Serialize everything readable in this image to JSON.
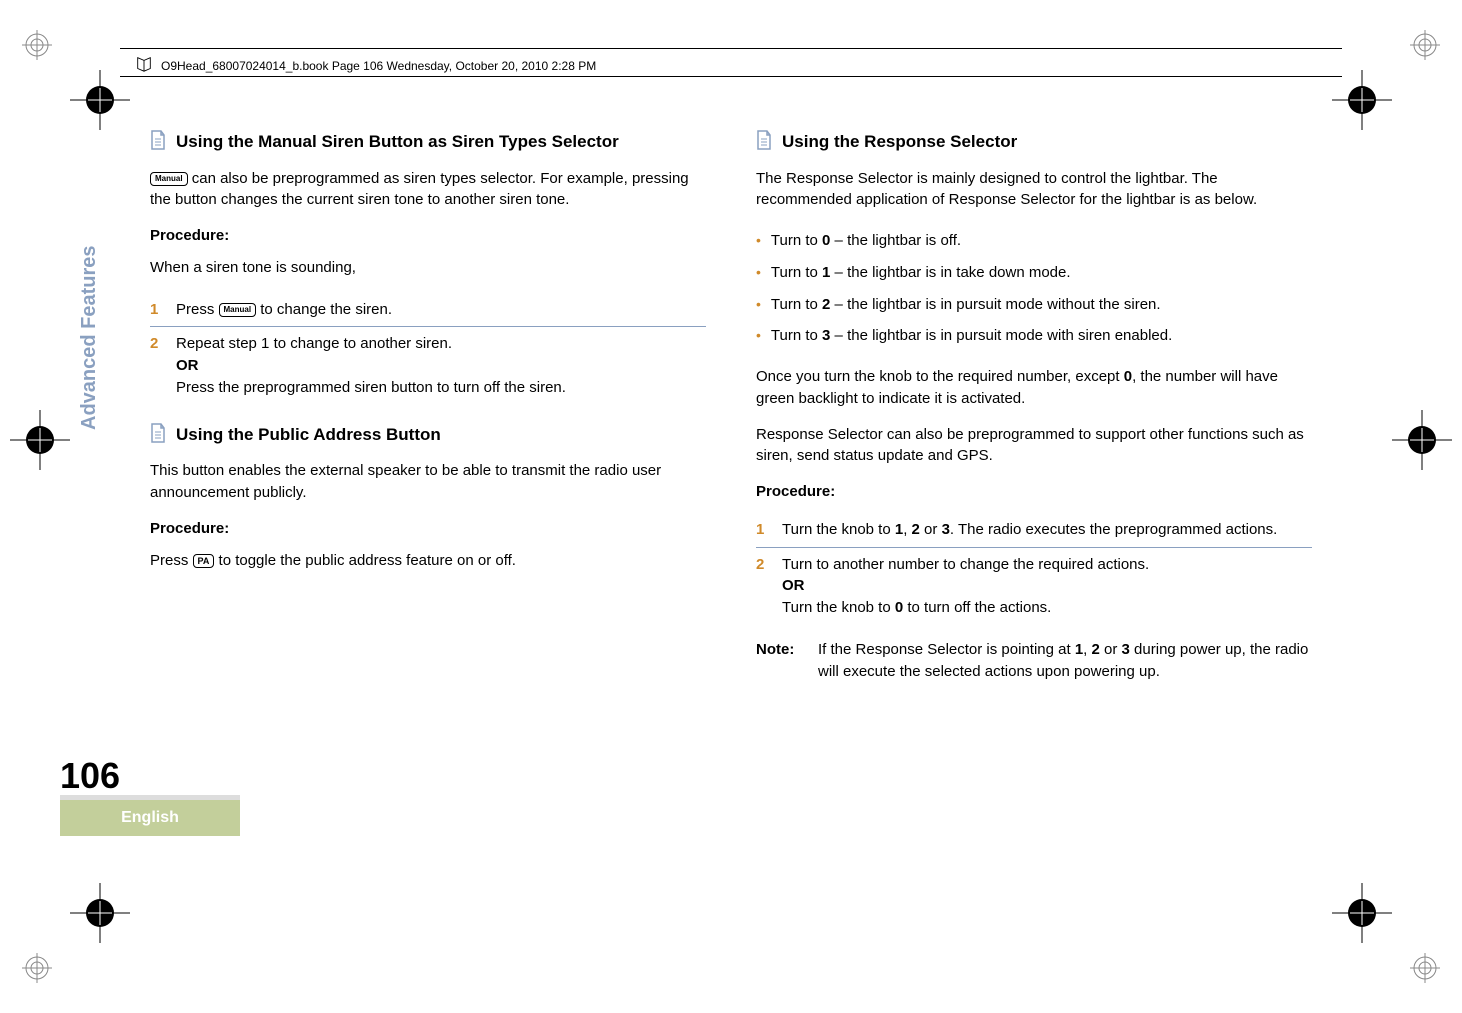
{
  "header": {
    "text": "O9Head_68007024014_b.book  Page 106  Wednesday, October 20, 2010  2:28 PM"
  },
  "sidebar": {
    "section_label": "Advanced Features",
    "page_number": "106",
    "language": "English"
  },
  "left": {
    "s1_title": "Using the Manual Siren Button as Siren Types Selector",
    "s1_btn": "Manual",
    "s1_p1a": " can also be preprogrammed as siren types selector. For example, pressing the button changes the current siren tone to another siren tone.",
    "proc_label": "Procedure:",
    "s1_p2": "When a siren tone is sounding,",
    "s1_step1_num": "1",
    "s1_step1_a": "Press ",
    "s1_step1_btn": "Manual",
    "s1_step1_b": " to change the siren.",
    "s1_step2_num": "2",
    "s1_step2_a": "Repeat step 1 to change to another siren.",
    "s1_step2_or": "OR",
    "s1_step2_b": "Press the preprogrammed siren button to turn off the siren.",
    "s2_title": "Using the Public Address Button",
    "s2_p1": "This button enables the external speaker to be able to transmit the radio user announcement publicly.",
    "s2_p2a": "Press ",
    "s2_btn": "PA",
    "s2_p2b": " to toggle the public address feature on or off."
  },
  "right": {
    "s1_title": "Using the Response Selector",
    "s1_p1": "The Response Selector is mainly designed to control the lightbar. The recommended application of Response Selector for the lightbar is as below.",
    "b1a": "Turn to ",
    "b1b": "0",
    "b1c": " – the lightbar is off.",
    "b2a": "Turn to ",
    "b2b": "1",
    "b2c": " – the lightbar is in take down mode.",
    "b3a": "Turn to ",
    "b3b": "2",
    "b3c": " – the lightbar is in pursuit mode without the siren.",
    "b4a": "Turn to ",
    "b4b": "3",
    "b4c": " – the lightbar is in pursuit mode with siren enabled.",
    "p2a": "Once you turn the knob to the required number, except ",
    "p2b": "0",
    "p2c": ", the number will have green backlight to indicate it is activated.",
    "p3": "Response Selector can also be preprogrammed to support other functions such as siren, send status update and GPS.",
    "proc_label": "Procedure:",
    "step1_num": "1",
    "step1a": "Turn the knob to ",
    "step1b": "1",
    "step1c": ", ",
    "step1d": "2",
    "step1e": " or ",
    "step1f": "3",
    "step1g": ". The radio executes the preprogrammed actions.",
    "step2_num": "2",
    "step2a": "Turn to another number to change the required actions.",
    "step2_or": "OR",
    "step2b1": "Turn the knob to ",
    "step2b2": "0",
    "step2b3": " to turn off the actions.",
    "note_label": "Note:",
    "note_a": "If the Response Selector is pointing at ",
    "note_b": "1",
    "note_c": ", ",
    "note_d": "2",
    "note_e": " or ",
    "note_f": "3",
    "note_g": " during power up, the radio will execute the selected actions upon powering up."
  }
}
